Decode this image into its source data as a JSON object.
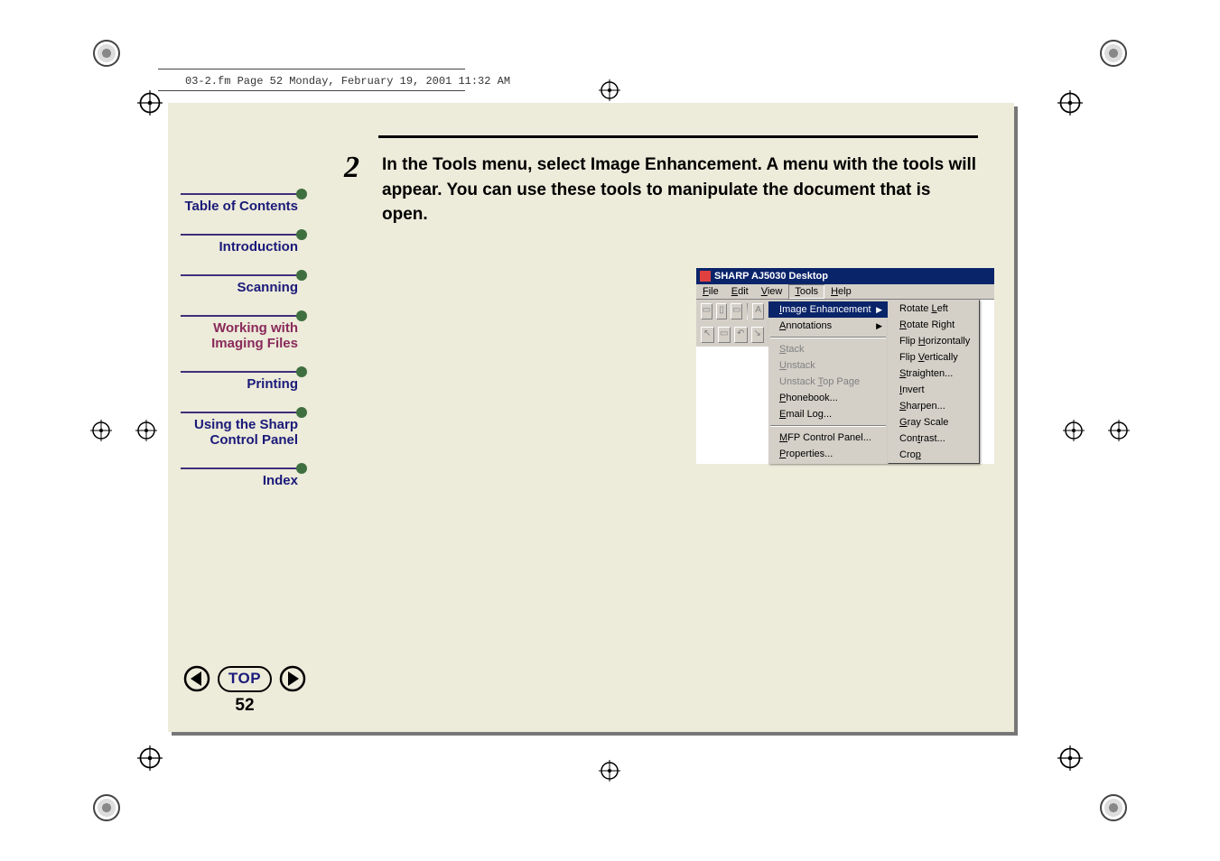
{
  "slug": "03-2.fm  Page 52  Monday, February 19, 2001  11:32 AM",
  "sidebar": {
    "items": [
      {
        "label": "Table of Contents"
      },
      {
        "label": "Introduction"
      },
      {
        "label": "Scanning"
      },
      {
        "label": "Working with Imaging Files",
        "current": true
      },
      {
        "label": "Printing"
      },
      {
        "label": "Using the Sharp Control Panel"
      },
      {
        "label": "Index"
      }
    ]
  },
  "pager": {
    "top_label": "TOP",
    "page_num": "52"
  },
  "step": {
    "number": "2",
    "text": "In the Tools menu, select Image Enhancement. A menu with the tools will appear. You can use these tools to manipulate the document that is open."
  },
  "shot": {
    "title": "SHARP AJ5030 Desktop",
    "menubar": [
      "File",
      "Edit",
      "View",
      "Tools",
      "Help"
    ],
    "tools_menu": {
      "sections": [
        [
          {
            "label": "Image Enhancement",
            "arrow": true,
            "hi": true,
            "u": "I"
          },
          {
            "label": "Annotations",
            "arrow": true,
            "u": "A"
          }
        ],
        [
          {
            "label": "Stack",
            "disabled": true,
            "u": "S"
          },
          {
            "label": "Unstack",
            "disabled": true,
            "u": "U"
          },
          {
            "label": "Unstack Top Page",
            "disabled": true,
            "u": "T"
          },
          {
            "label": "Phonebook...",
            "u": "P"
          },
          {
            "label": "Email Log...",
            "u": "E"
          }
        ],
        [
          {
            "label": "MFP Control Panel...",
            "u": "M"
          },
          {
            "label": "Properties...",
            "u": "P"
          }
        ]
      ]
    },
    "submenu": [
      {
        "label": "Rotate Left",
        "u": "L"
      },
      {
        "label": "Rotate Right",
        "u": "R"
      },
      {
        "label": "Flip Horizontally",
        "u": "H"
      },
      {
        "label": "Flip Vertically",
        "u": "V"
      },
      {
        "label": "Straighten...",
        "u": "S"
      },
      {
        "label": "Invert",
        "u": "I"
      },
      {
        "label": "Sharpen...",
        "u": "S"
      },
      {
        "label": "Gray Scale",
        "u": "G"
      },
      {
        "label": "Contrast...",
        "u": "t"
      },
      {
        "label": "Crop",
        "u": "p"
      }
    ]
  }
}
